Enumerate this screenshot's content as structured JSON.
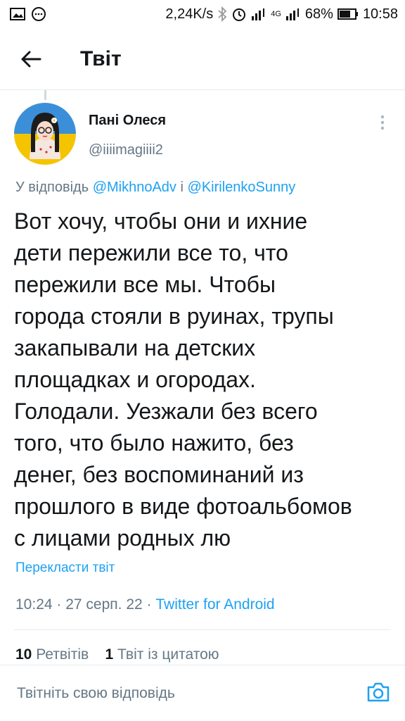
{
  "status_bar": {
    "speed": "2,24K/s",
    "battery": "68%",
    "time": "10:58",
    "network": "4G"
  },
  "header": {
    "title": "Твіт",
    "back_icon": "arrow-left-icon"
  },
  "tweet": {
    "author_name": "Пані Олеся",
    "author_handle": "@iiiimagiiii2",
    "reply_prefix": "У відповідь",
    "reply_mention_1": "@MikhnoAdv",
    "reply_conjunction": "і",
    "reply_mention_2": "@KirilenkoSunny",
    "text": "Вот хочу, чтобы они и ихние\nдети пережили все то, что\nпережили все мы. Чтобы\nгорода стояли в руинах, трупы\nзакапывали на детских\nплощадках и огородах.\nГолодали. Уезжали без всего\nтого, что было нажито, без\nденег, без воспоминаний из\nпрошлого в виде фотоальбомов\nс лицами родных лю",
    "translate_link": "Перекласти твіт",
    "time": "10:24",
    "date": "27 серп. 22",
    "client": "Twitter for Android"
  },
  "stats": {
    "retweets_count": "10",
    "retweets_label": "Ретвітів",
    "quotes_count": "1",
    "quotes_label": "Твіт із цитатою"
  },
  "reply_bar": {
    "placeholder": "Твітніть свою відповідь"
  },
  "colors": {
    "accent": "#1da1f2",
    "secondary_text": "#657786",
    "primary_text": "#14171a"
  }
}
